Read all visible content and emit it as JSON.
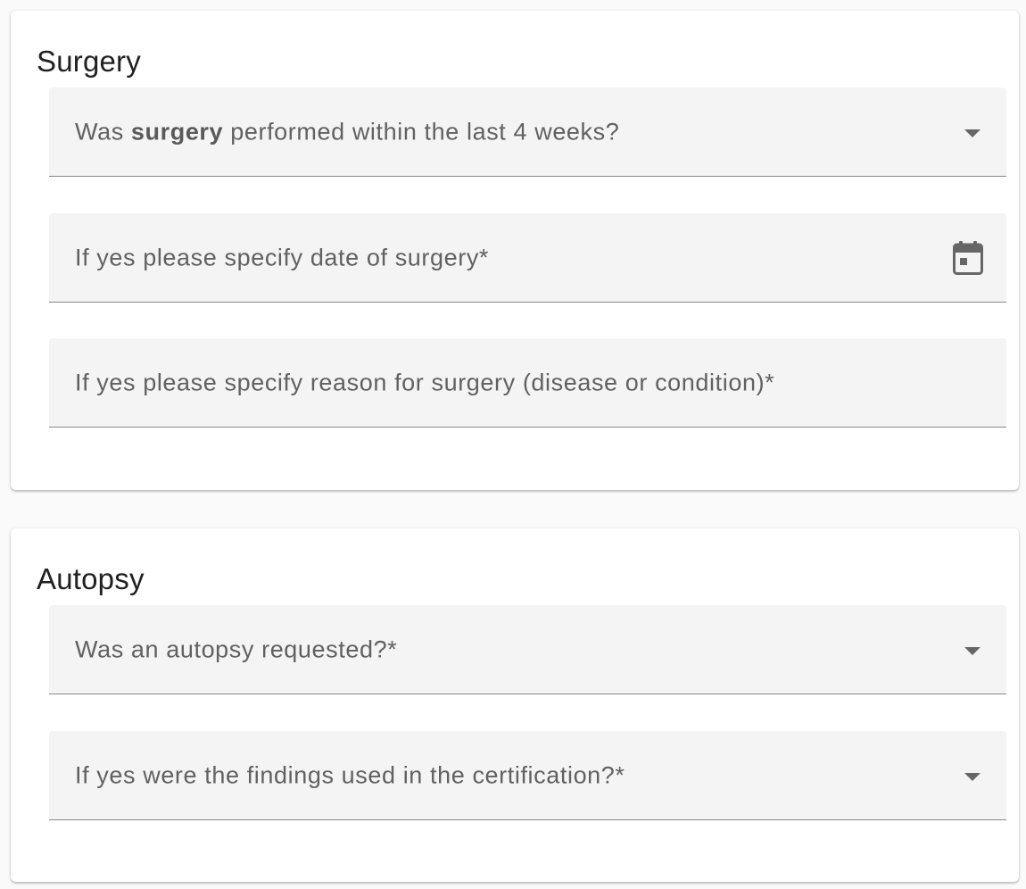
{
  "surgery": {
    "title": "Surgery",
    "fields": [
      {
        "label_prefix": "Was ",
        "label_bold": "surgery",
        "label_suffix": " performed within the last 4 weeks?",
        "type": "select",
        "icon": "chevron-down-icon"
      },
      {
        "label": "If yes please specify date of surgery*",
        "type": "date",
        "icon": "calendar-icon"
      },
      {
        "label": "If yes please specify reason for surgery (disease or condition)*",
        "type": "text"
      }
    ]
  },
  "autopsy": {
    "title": "Autopsy",
    "fields": [
      {
        "label": "Was an autopsy requested?*",
        "type": "select",
        "icon": "chevron-down-icon"
      },
      {
        "label": "If yes were the findings used in the certification?*",
        "type": "select",
        "icon": "chevron-down-icon"
      }
    ]
  },
  "colors": {
    "page_background": "#fafafa",
    "card_background": "#ffffff",
    "field_background": "#f4f4f4",
    "label_text": "#616161",
    "title_text": "#212121",
    "underline": "#8a8a8a",
    "icon": "#666666"
  }
}
